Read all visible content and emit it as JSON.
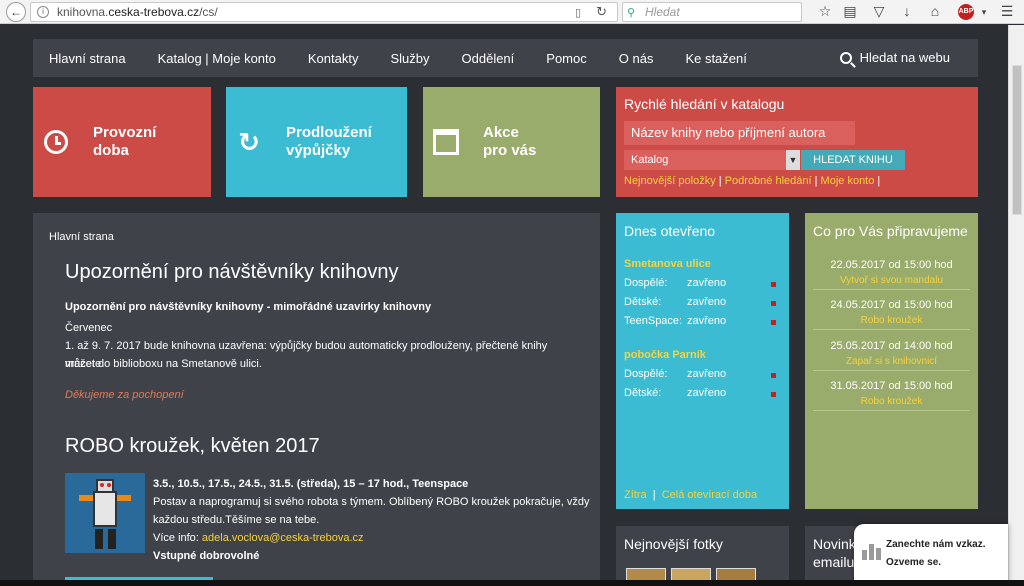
{
  "browser": {
    "url_path": "knihovna.",
    "url_host": "ceska-trebova.cz",
    "url_rest": "/cs/",
    "search_placeholder": "Hledat",
    "abp_label": "ABP"
  },
  "nav": {
    "items": [
      "Hlavní strana",
      "Katalog | Moje konto",
      "Kontakty",
      "Služby",
      "Oddělení",
      "Pomoc",
      "O nás",
      "Ke stažení"
    ],
    "search_label": "Hledat na webu"
  },
  "tiles": {
    "hours_line1": "Provozní",
    "hours_line2": "doba",
    "renew_line1": "Prodloužení",
    "renew_line2": "výpůjčky",
    "events_line1": "Akce",
    "events_line2": "pro vás"
  },
  "quick_search": {
    "title": "Rychlé hledání v katalogu",
    "placeholder": "Název knihy nebo příjmení autora",
    "select_value": "Katalog",
    "button": "HLEDAT KNIHU",
    "link1": "Nejnovější položky",
    "link2": "Podrobné hledání",
    "link3": "Moje konto",
    "separator": "|"
  },
  "main": {
    "breadcrumb": "Hlavní strana",
    "article1_title": "Upozornění pro návštěvníky knihovny",
    "article1_bold": "Upozornění pro návštěvníky knihovny - mimořádné uzavírky knihovny",
    "article1_month": "Červenec",
    "article1_text1": "1. až 9. 7. 2017 bude knihovna uzavřena: výpůjčky budou automaticky prodlouženy, přečtené knihy můžete",
    "article1_text2": "vracet do biblioboxu na Smetanově ulici.",
    "article1_italic": "Děkujeme za pochopení",
    "article2_title": "ROBO kroužek, květen 2017",
    "article2_dates": "3.5., 10.5., 17.5., 24.5., 31.5. (středa), 15 – 17 hod., Teenspace",
    "article2_text1": "Postav a naprogramuj si svého robota s týmem. Oblíbený ROBO kroužek pokračuje, vždy",
    "article2_text2": "každou středu.Těšíme se na tebe.",
    "article2_info_label": "Více info: ",
    "article2_email": "adela.voclova@ceska-trebova.cz",
    "article2_entry": "Vstupné dobrovolné"
  },
  "open_today": {
    "title": "Dnes otevřeno",
    "branch1": "Smetanova ulice",
    "branch1_rows": [
      {
        "label": "Dospělé:",
        "value": "zavřeno"
      },
      {
        "label": "Dětské:",
        "value": "zavřeno"
      },
      {
        "label": "TeenSpace:",
        "value": "zavřeno"
      }
    ],
    "branch2": "pobočka Parník",
    "branch2_rows": [
      {
        "label": "Dospělé:",
        "value": "zavřeno"
      },
      {
        "label": "Dětské:",
        "value": "zavřeno"
      }
    ],
    "link1": "Zítra",
    "link2": "Celá otevírací doba",
    "separator": "|"
  },
  "events": {
    "title": "Co pro Vás připravujeme",
    "items": [
      {
        "date": "22.05.2017 od 15:00 hod",
        "name": "Vytvoř si svou mandalu"
      },
      {
        "date": "24.05.2017 od 15:00 hod",
        "name": "Robo kroužek"
      },
      {
        "date": "25.05.2017 od 14:00 hod",
        "name": "Zapař si s knihovnicí"
      },
      {
        "date": "31.05.2017 od 15:00 hod",
        "name": "Robo kroužek"
      }
    ]
  },
  "photos": {
    "title": "Nejnovější fotky"
  },
  "newsletter": {
    "title_line1": "Novink",
    "title_line2": "emailu"
  },
  "chat": {
    "line1": "Zanechte nám vzkaz.",
    "line2": "Ozveme se."
  }
}
